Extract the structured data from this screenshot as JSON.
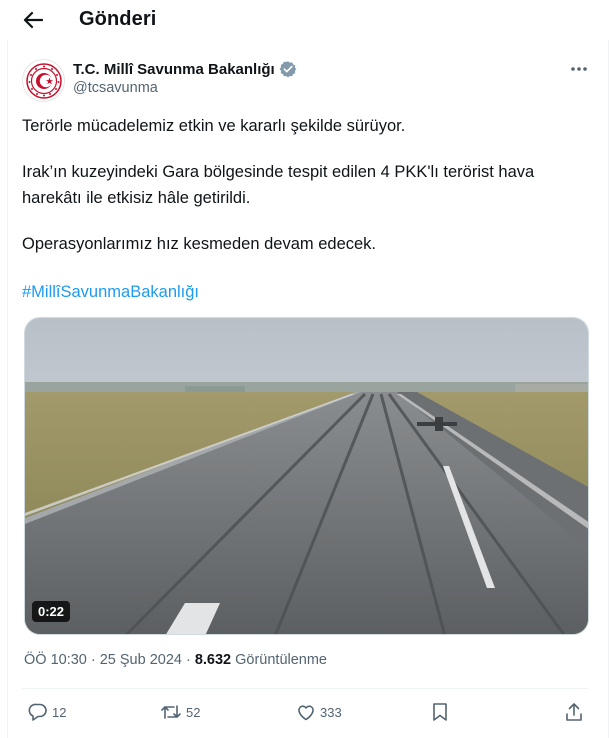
{
  "header": {
    "title": "Gönderi",
    "back_icon": "arrow-left-icon"
  },
  "author": {
    "display_name": "T.C. Millî Savunma Bakanlığı",
    "handle": "@tcsavunma",
    "verified": true,
    "verified_color": "#829aab"
  },
  "tweet": {
    "line1": "Terörle mücadelemiz etkin ve kararlı şekilde sürüyor.",
    "line2": "Irak’ın kuzeyindeki Gara bölgesinde tespit edilen 4 PKK'lı terörist hava",
    "line3": "harekâtı ile etkisiz hâle getirildi.",
    "line4": "Operasyonlarımız hız kesmeden devam edecek.",
    "hashtag": "#MillîSavunmaBakanlığı"
  },
  "media": {
    "type": "video",
    "duration": "0:22"
  },
  "meta": {
    "time": "ÖÖ 10:30",
    "separator": "·",
    "date": "25 Şub 2024",
    "views_count": "8.632",
    "views_label": "Görüntülenme"
  },
  "actions": {
    "replies": "12",
    "reposts": "52",
    "likes": "333"
  },
  "colors": {
    "link": "#1d9bf0",
    "secondary_text": "#536471",
    "primary_text": "#0f1419",
    "border": "#eff3f4"
  }
}
